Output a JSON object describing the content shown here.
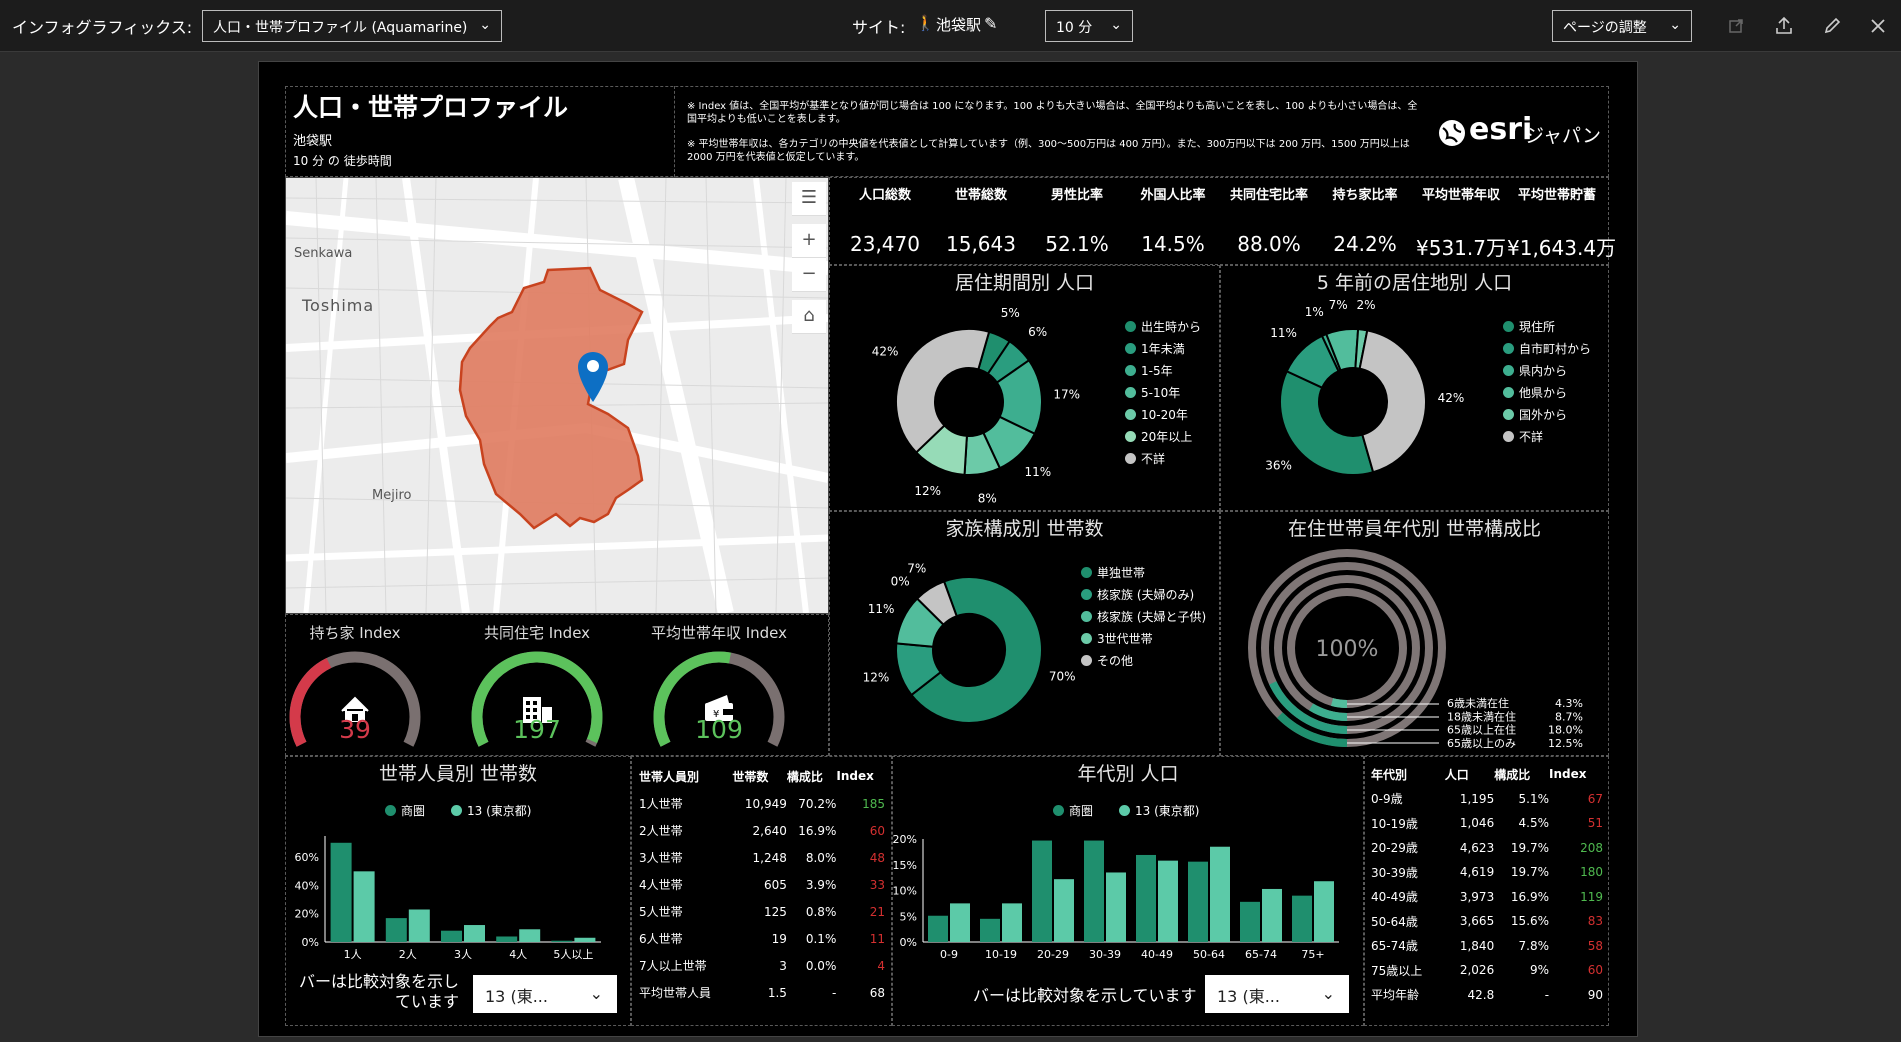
{
  "topbar": {
    "infographics_label": "インフォグラフィックス:",
    "template_select": "人口・世帯プロファイル (Aquamarine)",
    "site_label": "サイト:",
    "site_name": "池袋駅",
    "time_select": "10 分",
    "page_adjust": "ページの調整"
  },
  "header": {
    "title": "人口・世帯プロファイル",
    "station": "池袋駅",
    "walk": "10 分 の 徒歩時間",
    "note1": "※ Index 値は、全国平均が基準となり値が同じ場合は 100 になります。100 よりも大きい場合は、全国平均よりも高いことを表し、100 よりも小さい場合は、全国平均よりも低いことを表します。",
    "note2": "※ 平均世帯年収は、各カテゴリの中央値を代表値として計算しています（例、300～500万円は 400 万円）。また、300万円以下は 200 万円、1500 万円以上は 2000 万円を代表値と仮定しています。",
    "logo_text": "esri",
    "logo_sub": "ジャパン"
  },
  "map": {
    "labels": [
      "Senkawa",
      "Toshima",
      "Mejiro"
    ]
  },
  "kpis": [
    {
      "label": "人口総数",
      "value": "23,470"
    },
    {
      "label": "世帯総数",
      "value": "15,643"
    },
    {
      "label": "男性比率",
      "value": "52.1%"
    },
    {
      "label": "外国人比率",
      "value": "14.5%"
    },
    {
      "label": "共同住宅比率",
      "value": "88.0%"
    },
    {
      "label": "持ち家比率",
      "value": "24.2%"
    },
    {
      "label": "平均世帯年収",
      "value": "¥531.7万"
    },
    {
      "label": "平均世帯貯蓄",
      "value": "¥1,643.4万"
    }
  ],
  "indexes": [
    {
      "label": "持ち家 Index",
      "value": "39",
      "level": 0.39,
      "color": "#d43a4a",
      "icon": "house-icon"
    },
    {
      "label": "共同住宅 Index",
      "value": "197",
      "level": 0.985,
      "color": "#5cc25c",
      "icon": "building-icon"
    },
    {
      "label": "平均世帯年収 Index",
      "value": "109",
      "level": 0.545,
      "color": "#5cc25c",
      "icon": "wallet-icon"
    }
  ],
  "chart_data": [
    {
      "type": "pie",
      "title": "居住期間別 人口",
      "categories": [
        "出生時から",
        "1年未満",
        "1-5年",
        "5-10年",
        "10-20年",
        "20年以上",
        "不詳"
      ],
      "values": [
        5,
        6,
        17,
        11,
        8,
        12,
        42
      ],
      "labels": [
        "5%",
        "6%",
        "17%",
        "11%",
        "8%",
        "12%",
        "42%"
      ],
      "colors": [
        "#1f8f6e",
        "#2a9d7f",
        "#3dae8f",
        "#52bd9c",
        "#6ccaa8",
        "#96dbb7",
        "#c4c4c4"
      ]
    },
    {
      "type": "pie",
      "title": "5 年前の居住地別 人口",
      "categories": [
        "現住所",
        "自市町村から",
        "県内から",
        "他県から",
        "国外から",
        "不詳"
      ],
      "values": [
        36,
        11,
        1,
        7,
        2,
        42
      ],
      "labels": [
        "36%",
        "11%",
        "1%",
        "7%",
        "2%",
        "42%"
      ],
      "colors": [
        "#1f8f6e",
        "#2a9d7f",
        "#3dae8f",
        "#52bd9c",
        "#6ccaa8",
        "#c4c4c4"
      ]
    },
    {
      "type": "pie",
      "title": "家族構成別 世帯数",
      "categories": [
        "単独世帯",
        "核家族 (夫婦のみ)",
        "核家族 (夫婦と子供)",
        "3世代世帯",
        "その他"
      ],
      "values": [
        70,
        12,
        11,
        0,
        7
      ],
      "labels": [
        "70%",
        "12%",
        "11%",
        "0%",
        "7%"
      ],
      "colors": [
        "#1f8f6e",
        "#2a9d7f",
        "#52bd9c",
        "#6ccaa8",
        "#c4c4c4"
      ]
    },
    {
      "type": "pie",
      "title": "在住世帯員年代別 世帯構成比",
      "center_label": "100%",
      "categories": [
        "65歳以上のみ",
        "65歳以上在住",
        "18歳未満在住",
        "6歳未満在住"
      ],
      "values": [
        12.5,
        18.0,
        8.7,
        4.3
      ],
      "labels": [
        "12.5%",
        "18.0%",
        "8.7%",
        "4.3%"
      ],
      "colors": [
        "#1f8f6e",
        "#2a9d7f",
        "#3dae8f",
        "#52bd9c"
      ]
    },
    {
      "type": "bar",
      "title": "世帯人員別 世帯数",
      "categories": [
        "1人",
        "2人",
        "3人",
        "4人",
        "5人以上"
      ],
      "series": [
        {
          "name": "商圏",
          "values": [
            70.2,
            16.9,
            8.0,
            3.9,
            0.9
          ],
          "color": "#1f8f6e"
        },
        {
          "name": "13 (東京都)",
          "values": [
            50,
            23,
            12,
            9,
            3
          ],
          "color": "#5ccaa8"
        }
      ],
      "yticks": [
        "0%",
        "20%",
        "40%",
        "60%"
      ],
      "ylim": [
        0,
        75
      ],
      "note": "バーは比較対象を示しています",
      "compare_select": "13 (東..."
    },
    {
      "type": "table",
      "title": "世帯人員別",
      "columns": [
        "世帯人員別",
        "世帯数",
        "構成比",
        "Index"
      ],
      "rows": [
        [
          "1人世帯",
          "10,949",
          "70.2%",
          "185"
        ],
        [
          "2人世帯",
          "2,640",
          "16.9%",
          "60"
        ],
        [
          "3人世帯",
          "1,248",
          "8.0%",
          "48"
        ],
        [
          "4人世帯",
          "605",
          "3.9%",
          "33"
        ],
        [
          "5人世帯",
          "125",
          "0.8%",
          "21"
        ],
        [
          "6人世帯",
          "19",
          "0.1%",
          "11"
        ],
        [
          "7人以上世帯",
          "3",
          "0.0%",
          "4"
        ],
        [
          "平均世帯人員",
          "1.5",
          "-",
          "68"
        ]
      ]
    },
    {
      "type": "bar",
      "title": "年代別 人口",
      "categories": [
        "0-9",
        "10-19",
        "20-29",
        "30-39",
        "40-49",
        "50-64",
        "65-74",
        "75+"
      ],
      "series": [
        {
          "name": "商圏",
          "values": [
            5.1,
            4.5,
            19.7,
            19.7,
            16.9,
            15.6,
            7.8,
            9.0
          ],
          "color": "#1f8f6e"
        },
        {
          "name": "13 (東京都)",
          "values": [
            7.5,
            7.5,
            12.2,
            13.5,
            15.8,
            18.5,
            10.3,
            11.8
          ],
          "color": "#5ccaa8"
        }
      ],
      "yticks": [
        "0%",
        "5%",
        "10%",
        "15%",
        "20%"
      ],
      "ylim": [
        0,
        20
      ],
      "note": "バーは比較対象を示しています",
      "compare_select": "13 (東..."
    },
    {
      "type": "table",
      "title": "年代別",
      "columns": [
        "年代別",
        "人口",
        "構成比",
        "Index"
      ],
      "rows": [
        [
          "0-9歳",
          "1,195",
          "5.1%",
          "67"
        ],
        [
          "10-19歳",
          "1,046",
          "4.5%",
          "51"
        ],
        [
          "20-29歳",
          "4,623",
          "19.7%",
          "208"
        ],
        [
          "30-39歳",
          "4,619",
          "19.7%",
          "180"
        ],
        [
          "40-49歳",
          "3,973",
          "16.9%",
          "119"
        ],
        [
          "50-64歳",
          "3,665",
          "15.6%",
          "83"
        ],
        [
          "65-74歳",
          "1,840",
          "7.8%",
          "58"
        ],
        [
          "75歳以上",
          "2,026",
          "9%",
          "60"
        ],
        [
          "平均年齢",
          "42.8",
          "-",
          "90"
        ]
      ]
    }
  ]
}
